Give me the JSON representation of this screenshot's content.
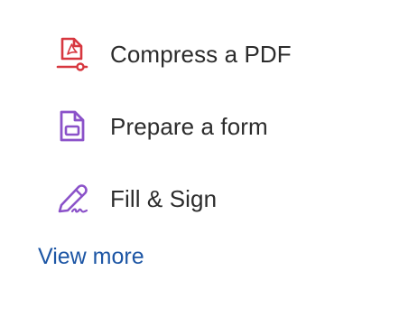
{
  "tools": [
    {
      "label": "Compress a PDF",
      "icon": "compress-pdf-icon",
      "color": "#d7373f"
    },
    {
      "label": "Prepare a form",
      "icon": "prepare-form-icon",
      "color": "#8b52c9"
    },
    {
      "label": "Fill & Sign",
      "icon": "fill-sign-icon",
      "color": "#8b52c9"
    }
  ],
  "view_more": {
    "label": "View more",
    "color": "#1d56a5"
  }
}
